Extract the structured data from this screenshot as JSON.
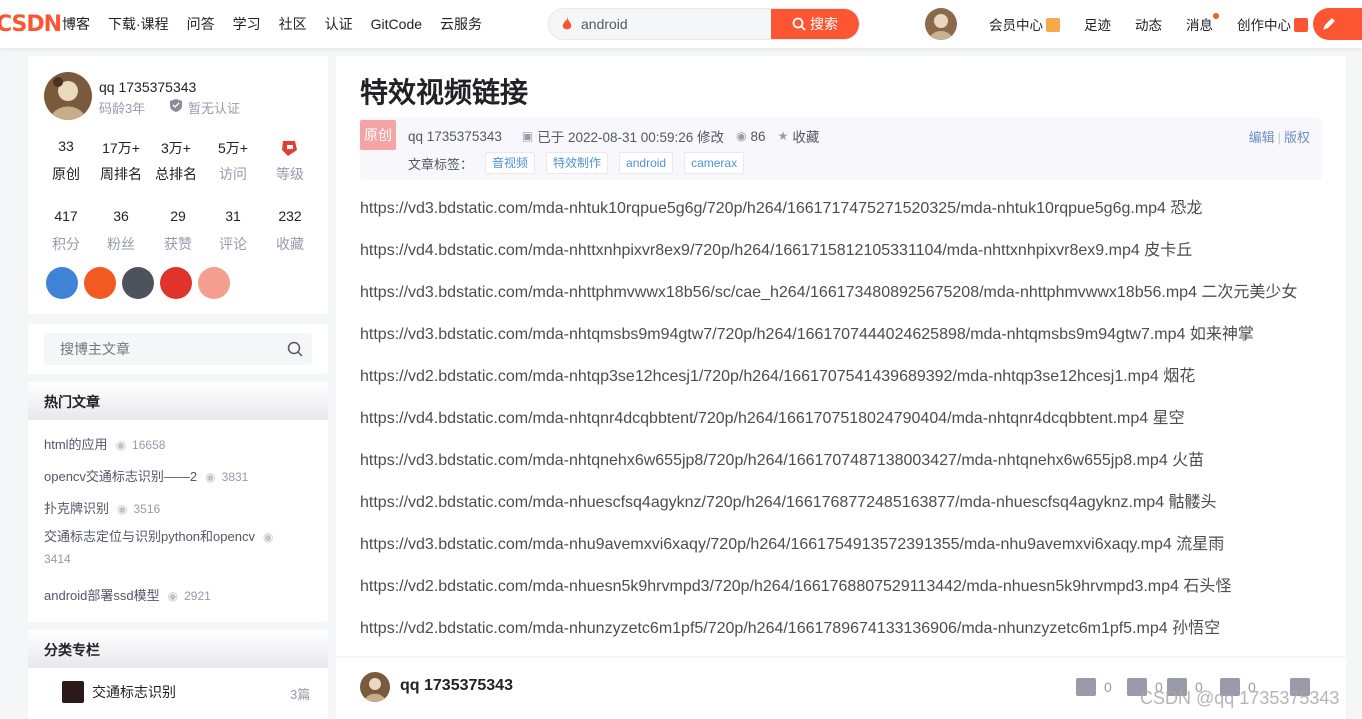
{
  "header": {
    "logo": "CSDN",
    "nav": [
      "博客",
      "下载·课程",
      "问答",
      "学习",
      "社区",
      "认证",
      "GitCode",
      "云服务"
    ],
    "search_value": "android",
    "search_button": "搜索",
    "right_nav": [
      "会员中心",
      "足迹",
      "动态",
      "消息",
      "创作中心"
    ]
  },
  "profile": {
    "name": "qq 1735375343",
    "code_age": "码龄3年",
    "cert": "暂无认证",
    "stats_row1": [
      {
        "num": "33",
        "label": "原创"
      },
      {
        "num": "17万+",
        "label": "周排名"
      },
      {
        "num": "3万+",
        "label": "总排名"
      },
      {
        "num": "5万+",
        "label": "访问"
      },
      {
        "num": "",
        "label": "等级"
      }
    ],
    "stats_row2": [
      {
        "num": "417",
        "label": "积分"
      },
      {
        "num": "36",
        "label": "粉丝"
      },
      {
        "num": "29",
        "label": "获赞"
      },
      {
        "num": "31",
        "label": "评论"
      },
      {
        "num": "232",
        "label": "收藏"
      }
    ]
  },
  "sidebar": {
    "search_placeholder": "搜博主文章",
    "hot_title": "热门文章",
    "hot": [
      {
        "title": "html的应用",
        "views": "16658"
      },
      {
        "title": "opencv交通标志识别——2",
        "views": "3831"
      },
      {
        "title": "扑克牌识别",
        "views": "3516"
      },
      {
        "title": "交通标志定位与识别python和opencv",
        "views": "3414"
      },
      {
        "title": "android部署ssd模型",
        "views": "2921"
      }
    ],
    "column_title": "分类专栏",
    "column": {
      "name": "交通标志识别",
      "count": "3篇"
    }
  },
  "article": {
    "title": "特效视频链接",
    "badge": "原创",
    "author": "qq 1735375343",
    "date": "已于 2022-08-31 00:59:26 修改",
    "views": "86",
    "favorite": "收藏",
    "edit": "编辑",
    "copyright": "版权",
    "tags_label": "文章标签：",
    "tags": [
      "音视频",
      "特效制作",
      "android",
      "camerax"
    ],
    "links": [
      "https://vd3.bdstatic.com/mda-nhtuk10rqpue5g6g/720p/h264/1661717475271520325/mda-nhtuk10rqpue5g6g.mp4 恐龙",
      "https://vd4.bdstatic.com/mda-nhttxnhpixvr8ex9/720p/h264/1661715812105331104/mda-nhttxnhpixvr8ex9.mp4 皮卡丘",
      "https://vd3.bdstatic.com/mda-nhttphmvwwx18b56/sc/cae_h264/1661734808925675208/mda-nhttphmvwwx18b56.mp4 二次元美少女",
      "https://vd3.bdstatic.com/mda-nhtqmsbs9m94gtw7/720p/h264/1661707444024625898/mda-nhtqmsbs9m94gtw7.mp4 如来神掌",
      "https://vd2.bdstatic.com/mda-nhtqp3se12hcesj1/720p/h264/1661707541439689392/mda-nhtqp3se12hcesj1.mp4 烟花",
      "https://vd4.bdstatic.com/mda-nhtqnr4dcqbbtent/720p/h264/1661707518024790404/mda-nhtqnr4dcqbbtent.mp4 星空",
      "https://vd3.bdstatic.com/mda-nhtqnehx6w655jp8/720p/h264/1661707487138003427/mda-nhtqnehx6w655jp8.mp4 火苗",
      "https://vd2.bdstatic.com/mda-nhuescfsq4agyknz/720p/h264/1661768772485163877/mda-nhuescfsq4agyknz.mp4 骷髅头",
      "https://vd3.bdstatic.com/mda-nhu9avemxvi6xaqy/720p/h264/1661754913572391355/mda-nhu9avemxvi6xaqy.mp4 流星雨",
      "https://vd2.bdstatic.com/mda-nhuesn5k9hrvmpd3/720p/h264/1661768807529113442/mda-nhuesn5k9hrvmpd3.mp4 石头怪",
      "https://vd2.bdstatic.com/mda-nhunzyzetc6m1pf5/720p/h264/1661789674133136906/mda-nhunzyzetc6m1pf5.mp4 孙悟空"
    ]
  },
  "footer": {
    "author": "qq 1735375343",
    "like": "0",
    "dislike": "0",
    "fav": "0",
    "comment": "0",
    "watermark": "CSDN @qq 1735375343"
  }
}
